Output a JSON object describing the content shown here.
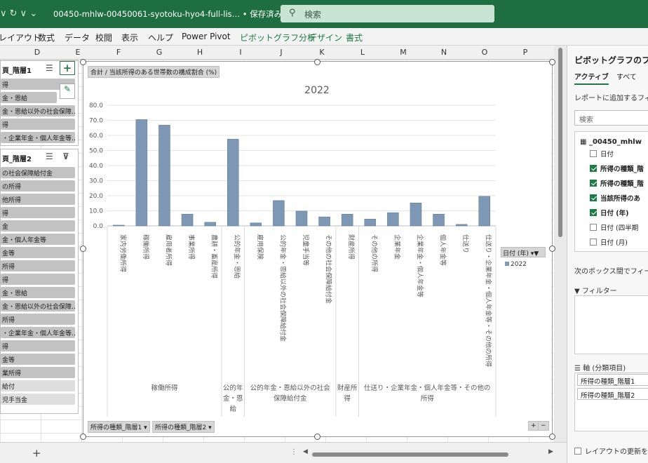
{
  "titlebar": {
    "left_controls": "∨  ↻ ∨ ⌄",
    "file_title": "00450-mhlw-00450061-syotoku-hyo4-full-lis… • 保存済み ∨",
    "search_placeholder": "検索"
  },
  "ribbon": {
    "tabs": [
      "レイアウト",
      "数式",
      "データ",
      "校閲",
      "表示",
      "ヘルプ",
      "Power Pivot",
      "ピボットグラフ分析",
      "デザイン",
      "書式"
    ]
  },
  "columns": [
    "D",
    "E",
    "F",
    "G",
    "H",
    "I",
    "J",
    "K",
    "L",
    "M",
    "N",
    "O",
    "P"
  ],
  "slicer1": {
    "title": "頁_階層1",
    "items": [
      "得",
      "金・恩給",
      "金・恩給以外の社会保障…",
      "得",
      "・企業年金・個人年金等…"
    ]
  },
  "slicer2": {
    "title": "頁_階層2",
    "items": [
      "の社会保障給付金",
      "の所得",
      "他所得",
      "得",
      "金",
      "金・個人年金等",
      "金等",
      "所得",
      "得",
      "金・恩給",
      "金・恩給以外の社会保障…",
      "所得",
      "・企業年金・個人年金等…",
      "得",
      "金等",
      "業所得",
      "給付",
      "児手当金"
    ]
  },
  "chart": {
    "field_button": "合計 / 当該所得のある世帯数の構成割合 (%)",
    "filter_buttons": [
      "所得の種類_階層1 ▾",
      "所得の種類_階層2 ▾"
    ],
    "legend_title": "日付 (年) ▾▼",
    "zoom_buttons": [
      "+",
      "−"
    ]
  },
  "chart_data": {
    "type": "bar",
    "title": "2022",
    "xlabel": "",
    "ylabel": "",
    "ylim": [
      0,
      80
    ],
    "yticks": [
      "0.0",
      "10.0",
      "20.0",
      "30.0",
      "40.0",
      "50.0",
      "60.0",
      "70.0",
      "80.0"
    ],
    "categories": [
      "家内労働所得",
      "稼働所得",
      "雇用者所得",
      "事業所得",
      "農耕・畜産所得",
      "公的年金・恩給",
      "雇用保険",
      "公的年金・恩給以外の社会保障給付金",
      "児童手当等",
      "その他の社会保障給付金",
      "財産所得",
      "その他の所得",
      "企業年金",
      "企業年金・個人年金等",
      "個人年金等",
      "仕送り",
      "仕送り・企業年金・個人年金等・その他の所得"
    ],
    "series": [
      {
        "name": "2022",
        "values": [
          0.5,
          70.5,
          66.8,
          7.8,
          2.4,
          57.5,
          2.0,
          16.8,
          9.8,
          6.0,
          7.8,
          4.5,
          8.8,
          15.2,
          7.8,
          1.0,
          19.6
        ]
      }
    ],
    "group_labels": [
      "稼働所得",
      "公的年金・恩給",
      "公的年金・恩給以外の社会保障給付金",
      "財産所得",
      "仕送り・企業年金・個人年金等・その他の所得"
    ],
    "group_label_lines": [
      [
        "稼働所得"
      ],
      [
        "公的年",
        "金・恩",
        "給"
      ],
      [
        "公的年金・恩給以外の社会",
        "保障給付金"
      ],
      [
        "財産所",
        "得"
      ],
      [
        "仕送り・企業年金・個人年金等・その他の",
        "所得"
      ]
    ],
    "legend": [
      "2022"
    ],
    "grid": true,
    "color": "#7d97b4"
  },
  "pane": {
    "title": "ピボットグラフのフィール",
    "tabs": [
      "アクティブ",
      "すべて"
    ],
    "instruction": "レポートに追加するフィール",
    "search_placeholder": "検索",
    "table_name": "_00450_mhlw",
    "fields": [
      {
        "label": "日付",
        "checked": false
      },
      {
        "label": "所得の種類_階",
        "checked": true
      },
      {
        "label": "所得の種類_階",
        "checked": true
      },
      {
        "label": "当該所得のあ",
        "checked": true
      },
      {
        "label": "日付 (年)",
        "checked": true
      },
      {
        "label": "日付 (四半期",
        "checked": false
      },
      {
        "label": "日付 (月)",
        "checked": false
      }
    ],
    "drag_text": "次のボックス間でフィールド",
    "filter_label": "フィルター",
    "axis_label": "軸 (分類項目)",
    "axis_items": [
      "所得の種類_階層1",
      "所得の種類_階層2"
    ],
    "defer_label": "レイアウトの更新を保"
  },
  "bottom": {
    "add_sheet": "+"
  }
}
